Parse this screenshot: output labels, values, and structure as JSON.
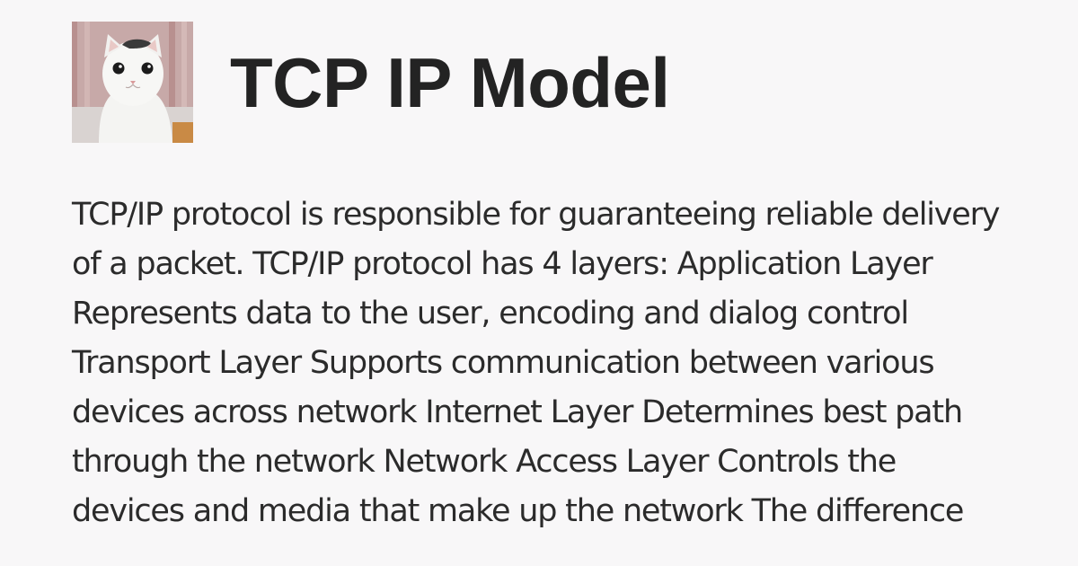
{
  "header": {
    "title": "TCP IP Model",
    "avatar_icon": "cat-photo"
  },
  "content": {
    "paragraph": "TCP/IP protocol is responsible for guaranteeing reliable delivery of a packet. TCP/IP protocol has 4 layers: Application Layer Represents data to the user, encoding and dialog control Transport Layer Supports communication between various devices across network Internet Layer Determines best path through the network Network Access Layer Controls the devices and media that make up the network The difference"
  },
  "colors": {
    "background": "#f8f7f8",
    "title": "#232323",
    "text": "#2b2b2b"
  }
}
